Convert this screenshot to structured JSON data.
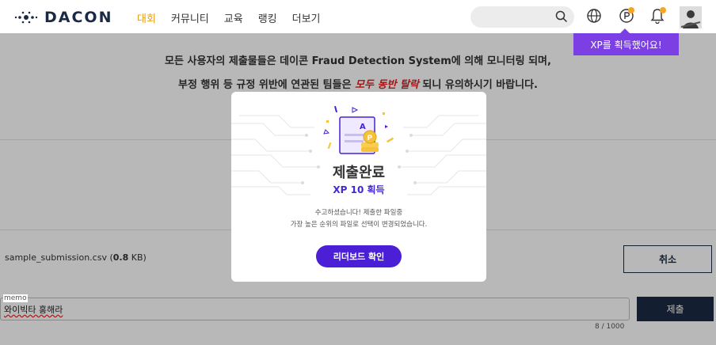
{
  "header": {
    "logo_text": "DACON",
    "nav": [
      {
        "label": "대회",
        "active": true
      },
      {
        "label": "커뮤니티",
        "active": false
      },
      {
        "label": "교육",
        "active": false
      },
      {
        "label": "랭킹",
        "active": false
      },
      {
        "label": "더보기",
        "active": false
      }
    ],
    "icons": [
      "search-icon",
      "globe-icon",
      "point-icon",
      "bell-icon",
      "avatar"
    ],
    "accent_color": "#e8a014"
  },
  "tooltip": {
    "text": "XP를 획득했어요!",
    "color": "#7b3fe4"
  },
  "notice": {
    "line1": "모든 사용자의 제출물들은 데이콘 Fraud Detection System에 의해 모니터링 되며,",
    "line2_before": "부정 행위 등 규정 위반에 연관된 팀들은 ",
    "line2_highlight": "모두 동반 탈락",
    "line2_after": " 되니 유의하시기 바랍니다."
  },
  "upload": {
    "file_name": "sample_submission.csv (",
    "file_size": "0.8",
    "file_unit": " KB)",
    "cancel_label": "취소"
  },
  "memo": {
    "label": "memo",
    "value": "와이빅타 홍해라",
    "counter": "8 / 1000",
    "submit_label": "제출"
  },
  "modal": {
    "title": "제출완료",
    "xp": "XP 10 획득",
    "message_line1": "수고하셨습니다! 제출한 파일중",
    "message_line2": "가장 높은 순위의 파일로 선택이 변경되었습니다.",
    "button_label": "리더보드 확인",
    "button_color": "#4a1fd6"
  }
}
